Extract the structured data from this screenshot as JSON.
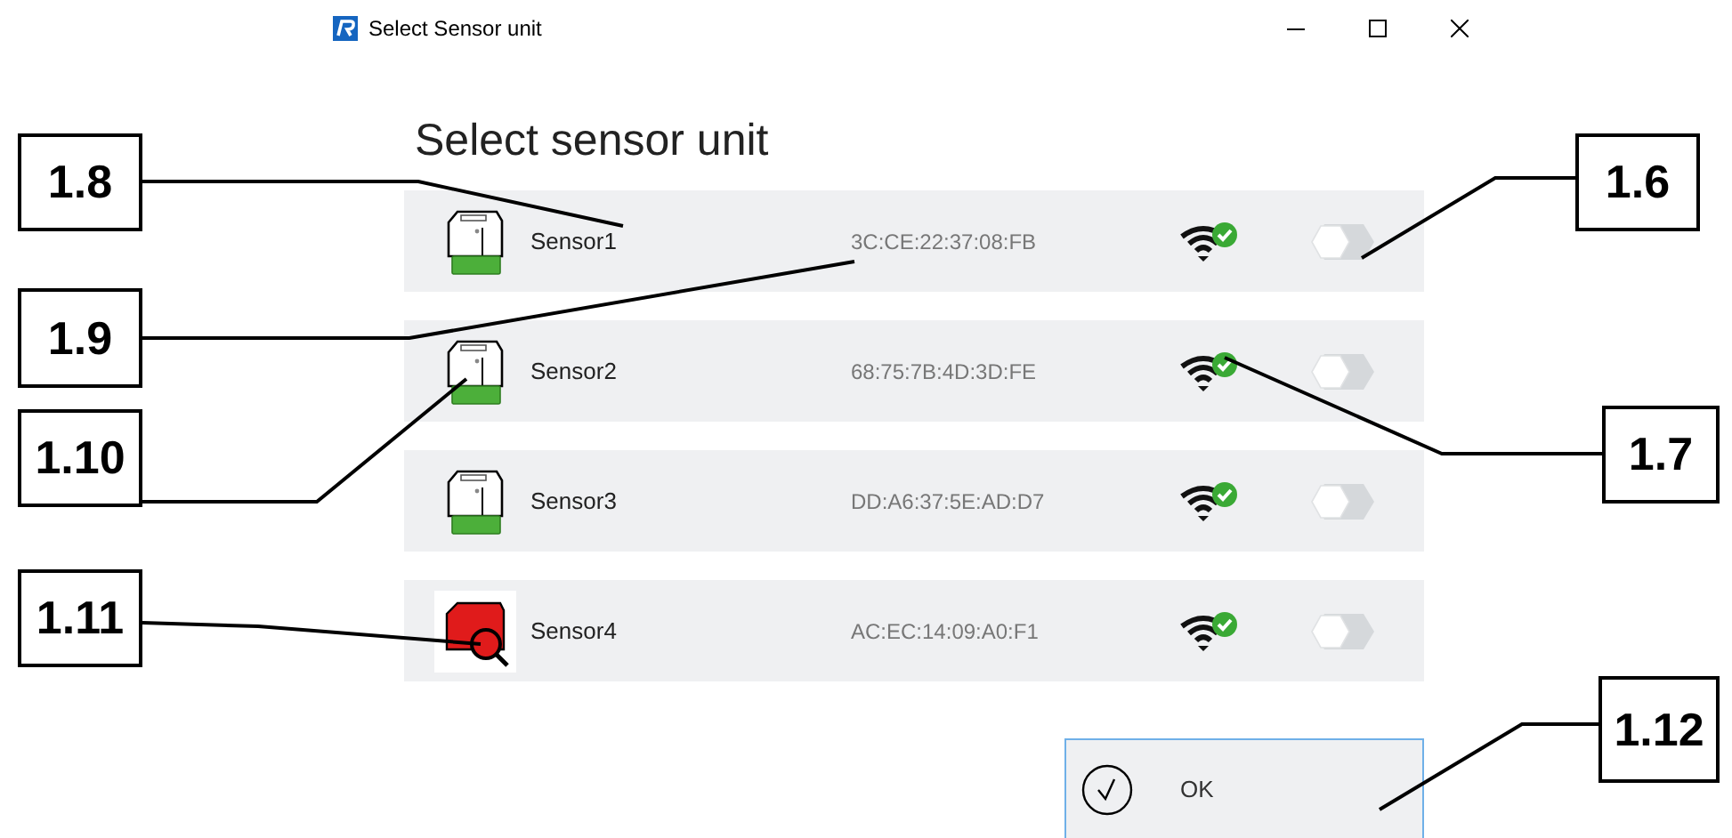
{
  "window": {
    "title": "Select Sensor unit"
  },
  "heading": "Select sensor unit",
  "sensors": [
    {
      "name": "Sensor1",
      "mac": "3C:CE:22:37:08:FB",
      "kind": "ready",
      "connected": true,
      "on": false
    },
    {
      "name": "Sensor2",
      "mac": "68:75:7B:4D:3D:FE",
      "kind": "ready",
      "connected": true,
      "on": false
    },
    {
      "name": "Sensor3",
      "mac": "DD:A6:37:5E:AD:D7",
      "kind": "ready",
      "connected": true,
      "on": false
    },
    {
      "name": "Sensor4",
      "mac": "AC:EC:14:09:A0:F1",
      "kind": "searching",
      "connected": true,
      "on": false
    }
  ],
  "ok_button": {
    "label": "OK"
  },
  "callouts": [
    {
      "label": "1.8"
    },
    {
      "label": "1.9"
    },
    {
      "label": "1.10"
    },
    {
      "label": "1.11"
    },
    {
      "label": "1.6"
    },
    {
      "label": "1.7"
    },
    {
      "label": "1.12"
    }
  ]
}
